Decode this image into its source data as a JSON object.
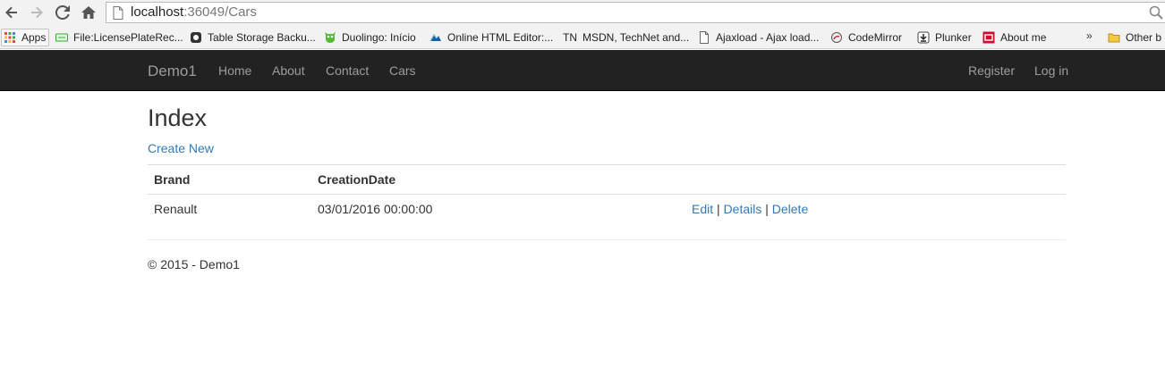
{
  "browser": {
    "url_host": "localhost",
    "url_rest": ":36049/Cars",
    "bookmarks": [
      {
        "label": "Apps",
        "icon": "apps-grid-icon"
      },
      {
        "label": "File:LicensePlateRec...",
        "icon": "license-plate-icon"
      },
      {
        "label": "Table Storage Backu...",
        "icon": "table-storage-icon"
      },
      {
        "label": "Duolingo: Início",
        "icon": "duolingo-owl-icon"
      },
      {
        "label": "Online HTML Editor:...",
        "icon": "html-editor-icon"
      },
      {
        "label": "MSDN, TechNet and...",
        "icon": "technet-icon",
        "prefix": "TN"
      },
      {
        "label": "Ajaxload - Ajax load...",
        "icon": "page-icon"
      },
      {
        "label": "CodeMirror",
        "icon": "codemirror-icon"
      },
      {
        "label": "Plunker",
        "icon": "plunker-icon"
      },
      {
        "label": "About me",
        "icon": "aboutme-icon"
      },
      {
        "label": "Other b",
        "icon": "folder-icon"
      }
    ],
    "more_label": "»"
  },
  "navbar": {
    "brand": "Demo1",
    "links": [
      "Home",
      "About",
      "Contact",
      "Cars"
    ],
    "right_links": [
      "Register",
      "Log in"
    ]
  },
  "main": {
    "title": "Index",
    "create_new": "Create New",
    "table": {
      "headers": [
        "Brand",
        "CreationDate"
      ],
      "rows": [
        {
          "brand": "Renault",
          "creation_date": "03/01/2016 00:00:00",
          "actions": [
            "Edit",
            "Details",
            "Delete"
          ],
          "separator": "|"
        }
      ]
    },
    "footer": "© 2015 - Demo1"
  },
  "colors": {
    "navbar_bg": "#222222",
    "nav_text": "#9d9d9d",
    "link": "#337ab7"
  }
}
